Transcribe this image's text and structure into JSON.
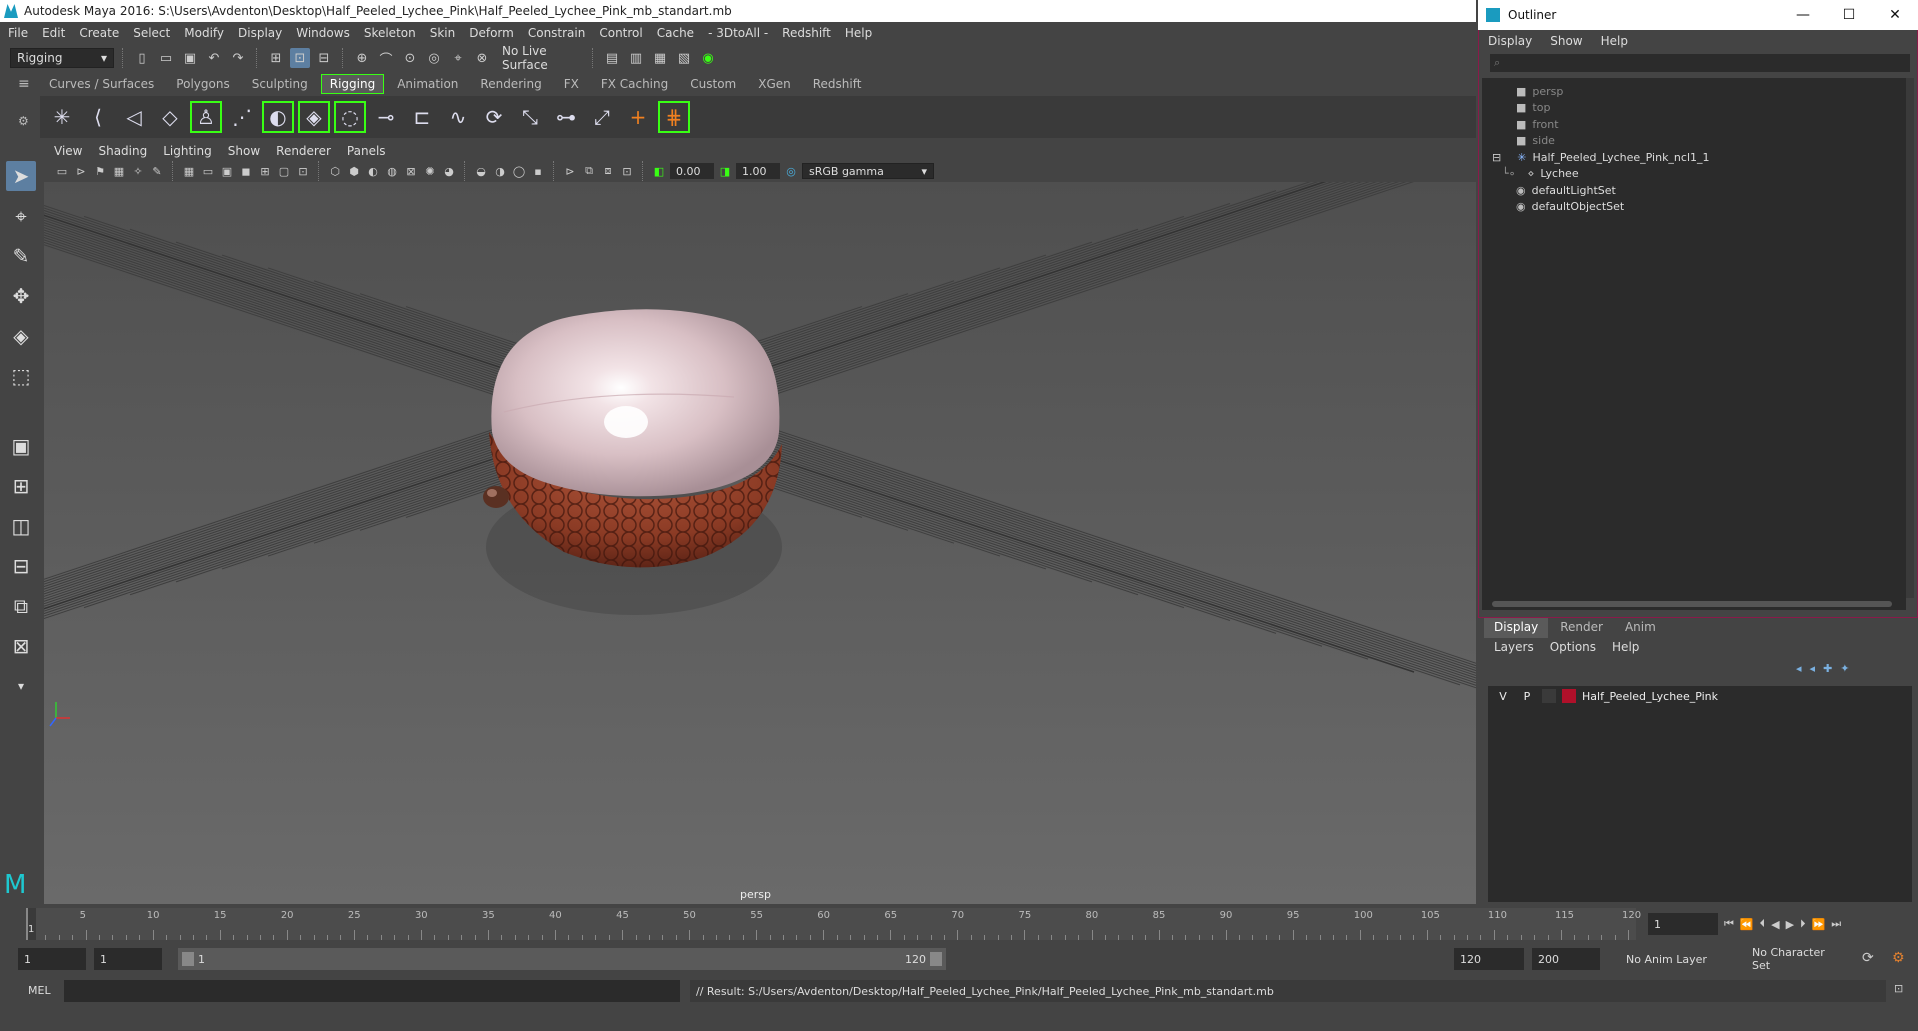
{
  "window": {
    "title": "Autodesk Maya 2016: S:\\Users\\Avdenton\\Desktop\\Half_Peeled_Lychee_Pink\\Half_Peeled_Lychee_Pink_mb_standart.mb"
  },
  "menu": [
    "File",
    "Edit",
    "Create",
    "Select",
    "Modify",
    "Display",
    "Windows",
    "Skeleton",
    "Skin",
    "Deform",
    "Constrain",
    "Control",
    "Cache",
    "- 3DtoAll -",
    "Redshift",
    "Help"
  ],
  "toolbar": {
    "menuset": "Rigging",
    "live_surface": "No Live Surface"
  },
  "shelf_tabs": [
    "Curves / Surfaces",
    "Polygons",
    "Sculpting",
    "Rigging",
    "Animation",
    "Rendering",
    "FX",
    "FX Caching",
    "Custom",
    "XGen",
    "Redshift"
  ],
  "shelf_active": "Rigging",
  "panel_menu": [
    "View",
    "Shading",
    "Lighting",
    "Show",
    "Renderer",
    "Panels"
  ],
  "panel_tools": {
    "exposure": "0.00",
    "gamma": "1.00",
    "colorspace": "sRGB gamma"
  },
  "viewport": {
    "camera_label": "persp"
  },
  "outliner": {
    "title": "Outliner",
    "menu": [
      "Display",
      "Show",
      "Help"
    ],
    "items": [
      {
        "label": "persp",
        "type": "camera",
        "dim": true
      },
      {
        "label": "top",
        "type": "camera",
        "dim": true
      },
      {
        "label": "front",
        "type": "camera",
        "dim": true
      },
      {
        "label": "side",
        "type": "camera",
        "dim": true
      },
      {
        "label": "Half_Peeled_Lychee_Pink_ncl1_1",
        "type": "group",
        "dim": false
      },
      {
        "label": "Lychee",
        "type": "mesh",
        "dim": false
      },
      {
        "label": "defaultLightSet",
        "type": "set",
        "dim": false
      },
      {
        "label": "defaultObjectSet",
        "type": "set",
        "dim": false
      }
    ]
  },
  "layers": {
    "tabs": [
      "Display",
      "Render",
      "Anim"
    ],
    "active_tab": "Display",
    "menu": [
      "Layers",
      "Options",
      "Help"
    ],
    "row": {
      "v": "V",
      "p": "P",
      "name": "Half_Peeled_Lychee_Pink",
      "color": "#b0102a"
    }
  },
  "timeline": {
    "ticks": [
      "5",
      "10",
      "15",
      "20",
      "25",
      "30",
      "35",
      "40",
      "45",
      "50",
      "55",
      "60",
      "65",
      "70",
      "75",
      "80",
      "85",
      "90",
      "95",
      "100",
      "105",
      "110",
      "115",
      "120"
    ],
    "start_marker": "1",
    "current_frame": "1",
    "range_start": "1",
    "range_start2": "1",
    "range_slider_start": "1",
    "range_slider_end": "120",
    "end": "120",
    "max_end": "200",
    "anim_layer": "No Anim Layer",
    "character_set": "No Character Set"
  },
  "command": {
    "lang": "MEL",
    "result": "// Result: S:/Users/Avdenton/Desktop/Half_Peeled_Lychee_Pink/Half_Peeled_Lychee_Pink_mb_standart.mb"
  },
  "colors": {
    "accent_green": "#39ff14",
    "outliner_border": "#8a1a4a",
    "selection_blue": "#5d7fa1"
  }
}
